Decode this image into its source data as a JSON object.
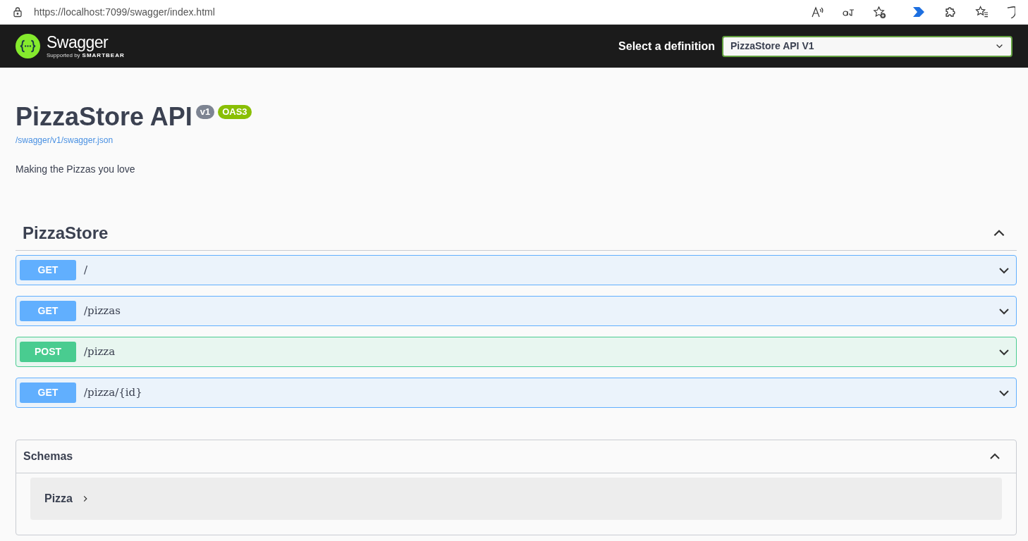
{
  "browser": {
    "url": "https://localhost:7099/swagger/index.html"
  },
  "topbar": {
    "logo_text": "Swagger",
    "logo_subtext": "Supported by",
    "logo_brand": "SMARTBEAR",
    "definition_label": "Select a definition",
    "definition_value": "PizzaStore API V1"
  },
  "info": {
    "title": "PizzaStore API",
    "version": "v1",
    "oas": "OAS3",
    "spec_link": "/swagger/v1/swagger.json",
    "description": "Making the Pizzas you love"
  },
  "tag": {
    "name": "PizzaStore",
    "expanded": true,
    "operations": [
      {
        "method": "GET",
        "path": "/",
        "expanded": false
      },
      {
        "method": "GET",
        "path": "/pizzas",
        "expanded": false
      },
      {
        "method": "POST",
        "path": "/pizza",
        "expanded": false
      },
      {
        "method": "GET",
        "path": "/pizza/{id}",
        "expanded": false
      }
    ]
  },
  "schemas": {
    "title": "Schemas",
    "expanded": true,
    "models": [
      {
        "name": "Pizza",
        "expanded": false
      }
    ]
  }
}
